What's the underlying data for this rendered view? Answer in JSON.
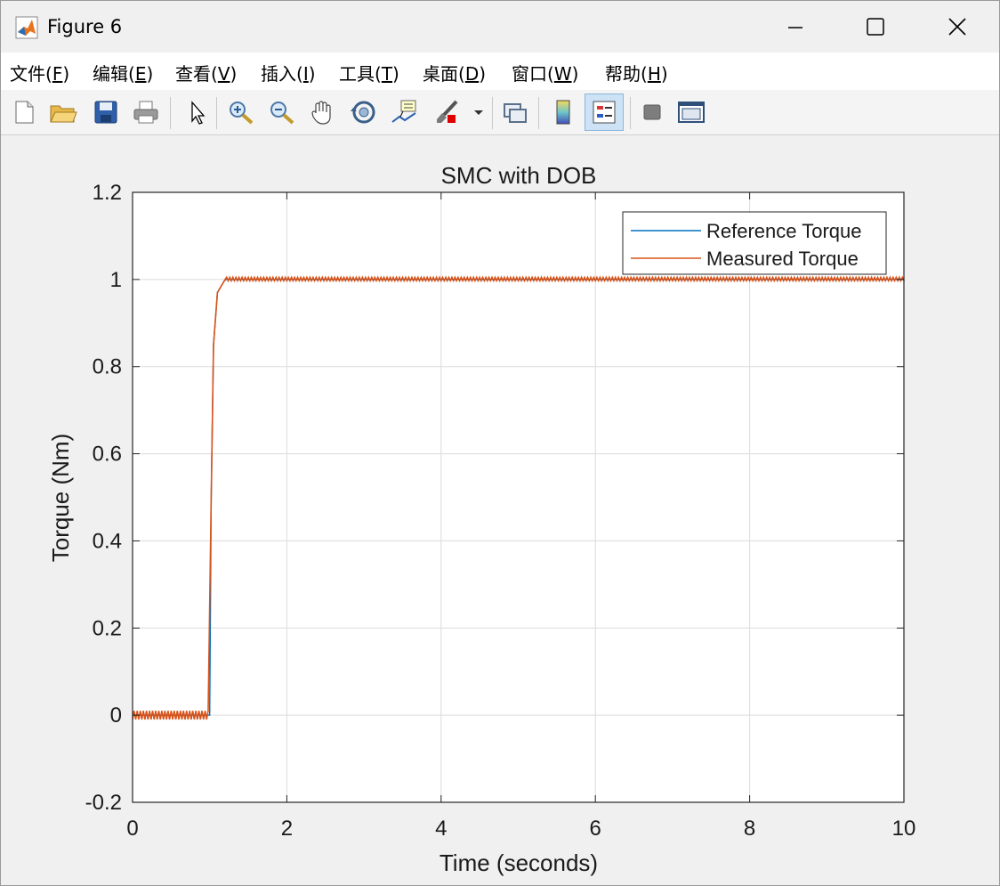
{
  "window": {
    "title": "Figure 6"
  },
  "menu": [
    {
      "label": "文件(",
      "key": "F",
      "end": ")"
    },
    {
      "label": "编辑(",
      "key": "E",
      "end": ")"
    },
    {
      "label": "查看(",
      "key": "V",
      "end": ")"
    },
    {
      "label": "插入(",
      "key": "I",
      "end": ")"
    },
    {
      "label": "工具(",
      "key": "T",
      "end": ")"
    },
    {
      "label": "桌面(",
      "key": "D",
      "end": ")"
    },
    {
      "label": "窗口(",
      "key": "W",
      "end": ")"
    },
    {
      "label": "帮助(",
      "key": "H",
      "end": ")"
    }
  ],
  "toolbar": {
    "icons": [
      "new-figure-icon",
      "open-file-icon",
      "save-icon",
      "print-icon",
      "select-arrow-icon",
      "zoom-in-icon",
      "zoom-out-icon",
      "pan-hand-icon",
      "rotate-3d-icon",
      "data-cursor-icon",
      "brush-icon",
      "link-plot-icon",
      "colorbar-icon",
      "legend-icon",
      "hide-plot-tools-icon",
      "show-plot-tools-icon"
    ],
    "active": "legend-icon"
  },
  "colors": {
    "reference": "#0072BD",
    "measured": "#D95319"
  },
  "chart_data": {
    "type": "line",
    "title": "SMC with DOB",
    "xlabel": "Time (seconds)",
    "ylabel": "Torque (Nm)",
    "xlim": [
      0,
      10
    ],
    "ylim": [
      -0.2,
      1.2
    ],
    "xticks": [
      "0",
      "2",
      "4",
      "6",
      "8",
      "10"
    ],
    "yticks": [
      "-0.2",
      "0",
      "0.2",
      "0.4",
      "0.6",
      "0.8",
      "1",
      "1.2"
    ],
    "grid": true,
    "legend_position": "top-right",
    "series": [
      {
        "name": "Reference Torque",
        "x": [
          0,
          1.0,
          1.02,
          1.05,
          1.1,
          1.2,
          10
        ],
        "y": [
          0,
          0,
          0.5,
          0.85,
          0.97,
          1.0,
          1.0
        ]
      },
      {
        "name": "Measured Torque",
        "x": [
          0,
          1.0,
          1.02,
          1.05,
          1.1,
          1.2,
          10
        ],
        "y": [
          0,
          0,
          0.5,
          0.85,
          0.97,
          1.0,
          1.0
        ],
        "chatter_amplitude": 0.01
      }
    ]
  }
}
